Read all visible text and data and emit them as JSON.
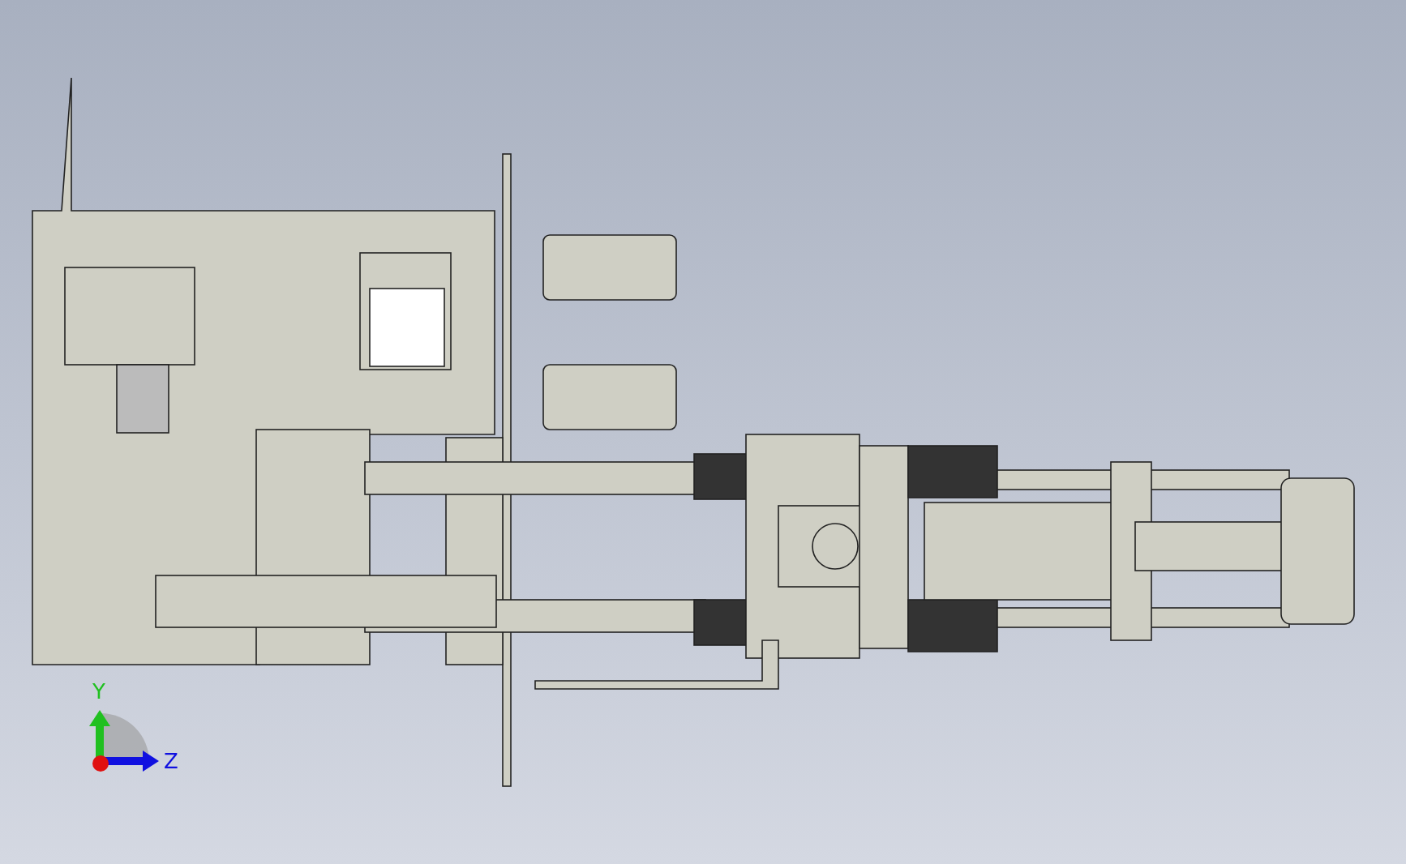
{
  "viewport": {
    "axes": [
      {
        "label": "Y",
        "kind": "vertical"
      },
      {
        "label": "Z",
        "kind": "horizontal"
      }
    ]
  }
}
